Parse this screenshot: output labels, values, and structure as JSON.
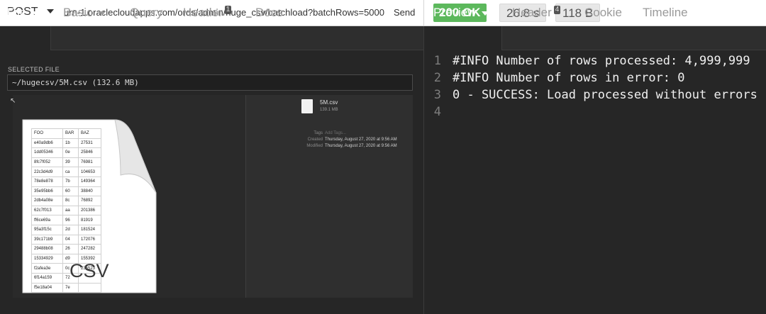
{
  "request": {
    "method": "POST",
    "url": "https://eu-frankfurt-1-ashburn-1.oraclecloudapps.com/ords/admin/huge_csv/batchload?batchRows=5000",
    "send_label": "Send"
  },
  "response": {
    "status": "200 OK",
    "time": "26.8 s",
    "size": "118 B"
  },
  "colors": {
    "status_ok": "#5cb85c"
  },
  "left_tabs": [
    {
      "label": "File",
      "badge": ""
    },
    {
      "label": "Basic",
      "badge": ""
    },
    {
      "label": "Query",
      "badge": ""
    },
    {
      "label": "Header",
      "badge": "1"
    },
    {
      "label": "Docs",
      "badge": ""
    }
  ],
  "selected_file": {
    "label": "SELECTED FILE",
    "value": "~/hugecsv/5M.csv (132.6 MB)"
  },
  "preview_file": {
    "name": "5M.csv",
    "size": "139.1 MB",
    "tags_key": "Tags",
    "tags_placeholder": "Add Tags...",
    "created_key": "Created",
    "created_value": "Thursday, August 27, 2020 at 9:56 AM",
    "modified_key": "Modified",
    "modified_value": "Thursday, August 27, 2020 at 9:56 AM",
    "icon_label": "CSV",
    "table": {
      "header": [
        "FOO",
        "BAR",
        "BAZ"
      ],
      "rows": [
        [
          "e40a9db6",
          "1b",
          "27531"
        ],
        [
          "1dd05346",
          "0e",
          "25846"
        ],
        [
          "8fc7f052",
          "39",
          "76981"
        ],
        [
          "22c3d4d9",
          "ca",
          "104653"
        ],
        [
          "78e8e878",
          "7b",
          "149364"
        ],
        [
          "35e95bb6",
          "60",
          "38840"
        ],
        [
          "2db4a08e",
          "8c",
          "76892"
        ],
        [
          "62c7f013",
          "aa",
          "201386"
        ],
        [
          "ff6ce69a",
          "96",
          "81919"
        ],
        [
          "95a3f15c",
          "2d",
          "181524"
        ],
        [
          "39c171b9",
          "04",
          "172076"
        ],
        [
          "29488b08",
          "26",
          "247282"
        ],
        [
          "15334929",
          "d9",
          "155392"
        ],
        [
          "f2afea3e",
          "0c",
          "235523"
        ],
        [
          "6f14a159",
          "72",
          ""
        ],
        [
          "f5e18a04",
          "7e",
          ""
        ]
      ]
    }
  },
  "right_tabs": [
    {
      "label": "Preview",
      "badge": ""
    },
    {
      "label": "Header",
      "badge": "4"
    },
    {
      "label": "Cookie",
      "badge": ""
    },
    {
      "label": "Timeline",
      "badge": ""
    }
  ],
  "preview_lines": [
    {
      "num": "1",
      "text": "#INFO Number of rows processed: 4,999,999"
    },
    {
      "num": "2",
      "text": "#INFO Number of rows in error: 0"
    },
    {
      "num": "3",
      "text": "0 - SUCCESS: Load processed without errors"
    },
    {
      "num": "4",
      "text": ""
    }
  ]
}
